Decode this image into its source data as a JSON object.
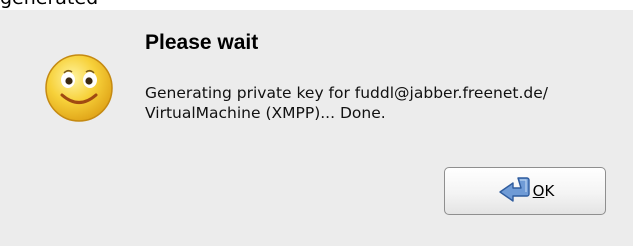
{
  "top_fragment": "generated",
  "dialog": {
    "title": "Please wait",
    "message": "Generating private key for fuddl@jabber.freenet.de/\nVirtualMachine (XMPP)... Done.",
    "icon": "smiley-face-icon",
    "ok_button": {
      "mnemonic": "O",
      "rest": "K",
      "icon": "return-arrow-icon"
    }
  },
  "colors": {
    "dialog_background": "#ececec",
    "icon_yellow": "#f7d13a",
    "arrow_blue": "#6f9bd6"
  }
}
